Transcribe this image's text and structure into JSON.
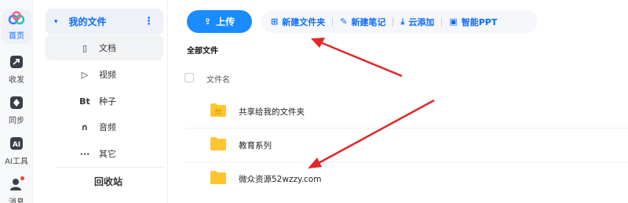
{
  "rail": {
    "items": [
      {
        "label": "首页",
        "icon": "cloud-logo-icon"
      },
      {
        "label": "收发",
        "icon": "send-icon"
      },
      {
        "label": "同步",
        "icon": "sync-icon"
      },
      {
        "label": "AI工具",
        "icon": "ai-icon"
      },
      {
        "label": "消息",
        "icon": "user-icon"
      }
    ]
  },
  "nav": {
    "header": {
      "label": "我的文件",
      "caret": "▾",
      "more": "⋮"
    },
    "subitems": [
      {
        "label": "文档",
        "icon": "doc-icon",
        "glyph": "▯"
      },
      {
        "label": "视频",
        "icon": "video-icon",
        "glyph": "▷"
      },
      {
        "label": "种子",
        "icon": "bt-icon",
        "glyph": "Bt"
      },
      {
        "label": "音频",
        "icon": "headphone-icon",
        "glyph": "∩"
      },
      {
        "label": "其它",
        "icon": "more-icon",
        "glyph": "···"
      }
    ],
    "recycle": "回收站"
  },
  "toolbar": {
    "upload_label": "上传",
    "upload_icon": "⇪",
    "actions": [
      {
        "label": "新建文件夹",
        "icon": "new-folder-icon",
        "glyph": "⊞"
      },
      {
        "label": "新建笔记",
        "icon": "new-note-icon",
        "glyph": "✎"
      },
      {
        "label": "云添加",
        "icon": "cloud-add-icon",
        "glyph": "⤓"
      },
      {
        "label": "智能PPT",
        "icon": "ppt-icon",
        "glyph": "▣"
      }
    ]
  },
  "breadcrumb": "全部文件",
  "list": {
    "header": "文件名",
    "files": [
      {
        "name": "共享给我的文件夹",
        "type": "shared-folder"
      },
      {
        "name": "教育系列",
        "type": "folder"
      },
      {
        "name": "微众资源52wzzy.com",
        "type": "folder"
      }
    ]
  },
  "colors": {
    "accent": "#0b6bff",
    "upload": "#1a8cff",
    "folder": "#ffc52e",
    "arrow": "#e0282a"
  }
}
